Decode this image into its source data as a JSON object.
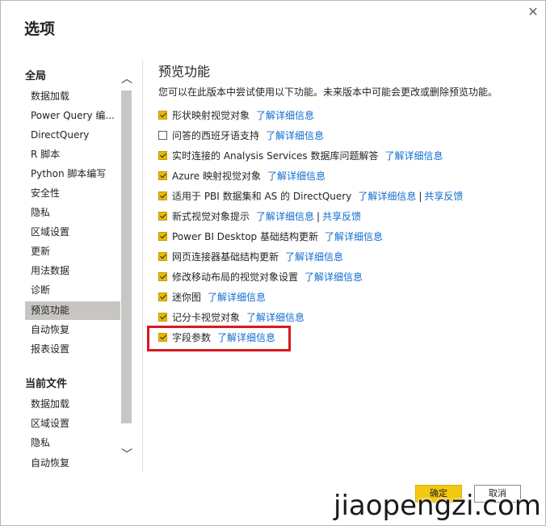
{
  "dialog": {
    "title": "选项",
    "close_glyph": "✕"
  },
  "sidebar": {
    "sections": [
      {
        "header": "全局",
        "items": [
          "数据加载",
          "Power Query 编...",
          "DirectQuery",
          "R 脚本",
          "Python 脚本编写",
          "安全性",
          "隐私",
          "区域设置",
          "更新",
          "用法数据",
          "诊断",
          "预览功能",
          "自动恢复",
          "报表设置"
        ]
      },
      {
        "header": "当前文件",
        "items": [
          "数据加载",
          "区域设置",
          "隐私",
          "自动恢复"
        ]
      }
    ],
    "selected": "预览功能",
    "scroll_up_glyph": "︿",
    "scroll_down_glyph": "﹀"
  },
  "content": {
    "title": "预览功能",
    "description": "您可以在此版本中尝试使用以下功能。未来版本中可能会更改或删除预览功能。",
    "features": [
      {
        "label": "形状映射视觉对象",
        "checked": true,
        "link": "了解详细信息"
      },
      {
        "label": "问答的西班牙语支持",
        "checked": false,
        "link": "了解详细信息"
      },
      {
        "label": "实时连接的 Analysis Services 数据库问题解答",
        "checked": true,
        "link": "了解详细信息"
      },
      {
        "label": "Azure 映射视觉对象",
        "checked": true,
        "link": "了解详细信息"
      },
      {
        "label": "适用于 PBI 数据集和 AS 的 DirectQuery",
        "checked": true,
        "link": "了解详细信息",
        "separator": "|",
        "link2": "共享反馈"
      },
      {
        "label": "新式视觉对象提示",
        "checked": true,
        "link": "了解详细信息",
        "separator": "|",
        "link2": "共享反馈"
      },
      {
        "label": "Power BI Desktop 基础结构更新",
        "checked": true,
        "link": "了解详细信息"
      },
      {
        "label": "网页连接器基础结构更新",
        "checked": true,
        "link": "了解详细信息"
      },
      {
        "label": "修改移动布局的视觉对象设置",
        "checked": true,
        "link": "了解详细信息"
      },
      {
        "label": "迷你图",
        "checked": true,
        "link": "了解详细信息"
      },
      {
        "label": "记分卡视觉对象",
        "checked": true,
        "link": "了解详细信息"
      },
      {
        "label": "字段参数",
        "checked": true,
        "link": "了解详细信息",
        "highlighted": true
      }
    ]
  },
  "buttons": {
    "ok": "确定",
    "cancel": "取消"
  },
  "watermark": "jiaopengzi.com",
  "colors": {
    "accent": "#f2c811",
    "checkbox": "#e8b800",
    "link": "#0f6ccf",
    "selected_bg": "#c8c6c4",
    "highlight_border": "#d8191f"
  }
}
